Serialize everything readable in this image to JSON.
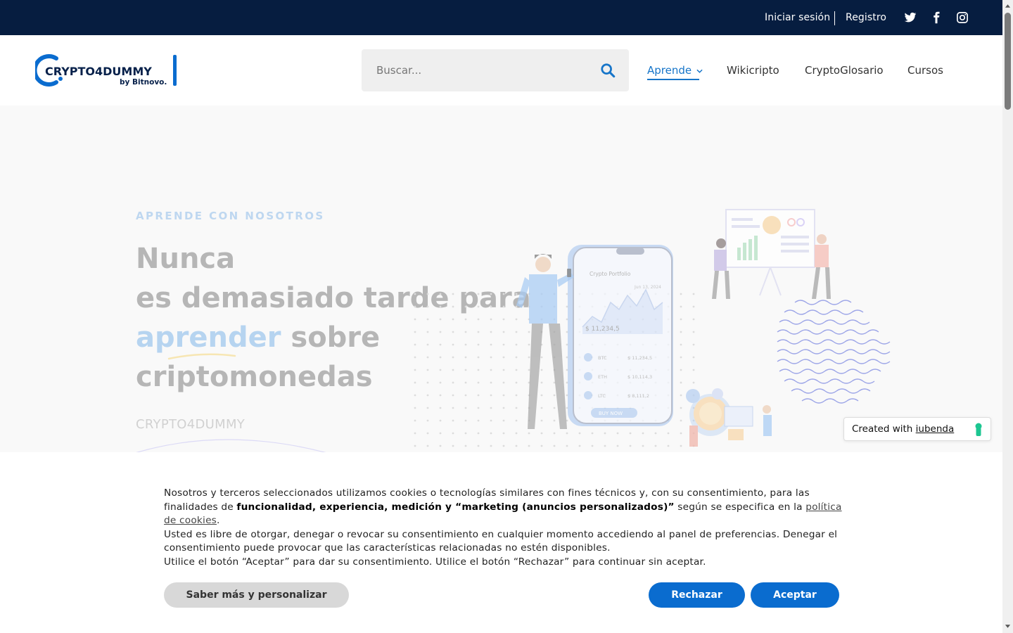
{
  "topbar": {
    "login": "Iniciar sesión",
    "register": "Registro",
    "social_icons": [
      "twitter-icon",
      "facebook-icon",
      "instagram-icon"
    ]
  },
  "header": {
    "logo_text": "CRYPTO4DUMMY",
    "logo_sub": "by Bitnovo.",
    "search_placeholder": "Buscar...",
    "nav": [
      {
        "label": "Aprende",
        "active": true
      },
      {
        "label": "Wikicripto"
      },
      {
        "label": "CryptoGlosario"
      },
      {
        "label": "Cursos"
      }
    ]
  },
  "hero": {
    "eyebrow": "APRENDE CON NOSOTROS",
    "line1": "Nunca",
    "line2": "es demasiado tarde para",
    "highlight": "aprender",
    "line3_rest": " sobre",
    "line4": "criptomonedas",
    "brand": "CRYPTO4DUMMY",
    "phone": {
      "title": "Crypto Portfolio",
      "date": "Jun 13, 2024",
      "balance": "$ 11,234,5",
      "rows": [
        {
          "coin": "BTC",
          "value": "$ 11,234,5"
        },
        {
          "coin": "ETH",
          "value": "$ 10,114,3"
        },
        {
          "coin": "LTC",
          "value": "$ 8,111,2"
        }
      ],
      "cta": "BUY NOW"
    }
  },
  "badge": {
    "prefix": "Created with ",
    "brand": "iubenda"
  },
  "cookie": {
    "p1_a": "Nosotros y terceros seleccionados utilizamos cookies o tecnologías similares con fines técnicos y, con su consentimiento, para las finalidades de ",
    "p1_bold": "funcionalidad, experiencia, medición y “marketing (anuncios personalizados)”",
    "p1_b": " según se especifica en la ",
    "p1_link": "política de cookies",
    "p1_end": ".",
    "p2": "Usted es libre de otorgar, denegar o revocar su consentimiento en cualquier momento accediendo al panel de preferencias. Denegar el consentimiento puede provocar que las características relacionadas no estén disponibles.",
    "p3": "Utilice el botón “Aceptar” para dar su consentimiento. Utilice el botón “Rechazar” para continuar sin aceptar.",
    "btn_more": "Saber más y personalizar",
    "btn_reject": "Rechazar",
    "btn_accept": "Aceptar"
  },
  "colors": {
    "topbar": "#061d40",
    "accent": "#1675c9",
    "button": "#0a6ccf"
  }
}
